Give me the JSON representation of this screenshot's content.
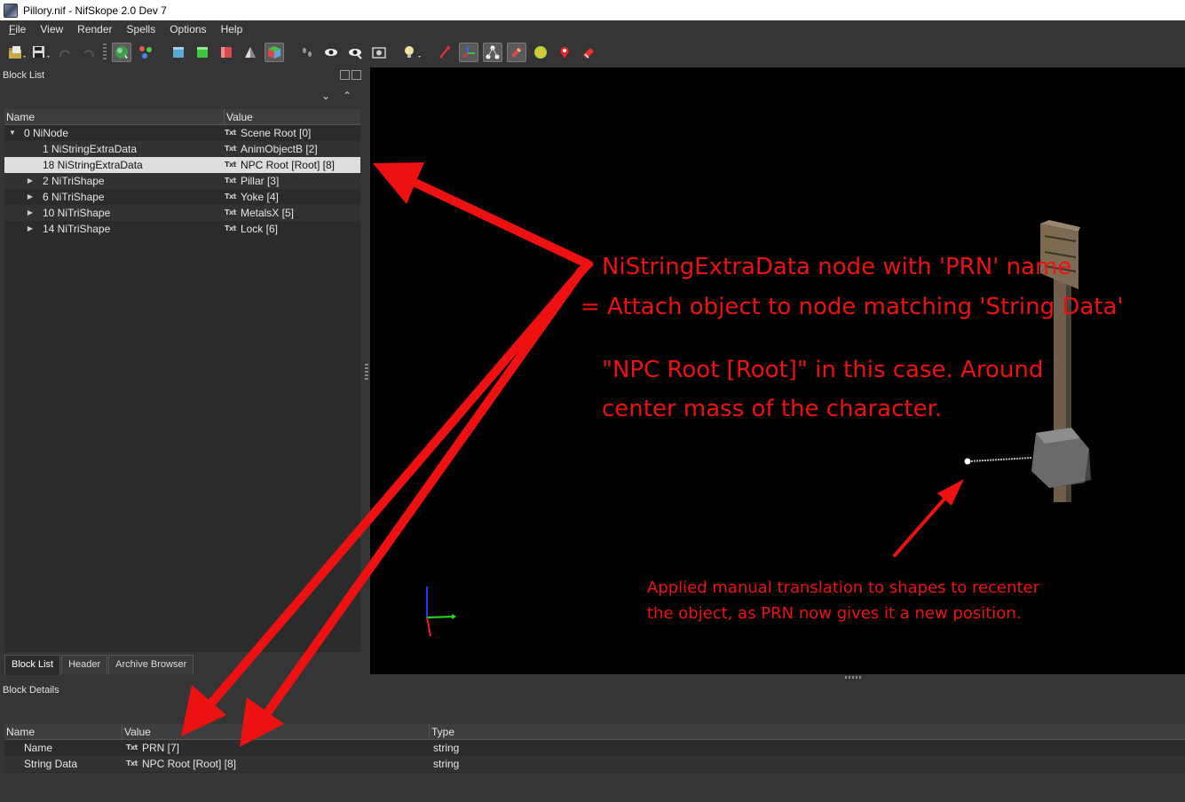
{
  "window": {
    "title": "Pillory.nif - NifSkope 2.0 Dev 7"
  },
  "menu": [
    {
      "label": "File",
      "ul": "F",
      "rest": "ile"
    },
    {
      "label": "View",
      "ul": "",
      "rest": "View"
    },
    {
      "label": "Render",
      "ul": "",
      "rest": "Render"
    },
    {
      "label": "Spells",
      "ul": "",
      "rest": "Spells"
    },
    {
      "label": "Options",
      "ul": "",
      "rest": "Options"
    },
    {
      "label": "Help",
      "ul": "",
      "rest": "Help"
    }
  ],
  "toolbar_icons": [
    "open-icon",
    "save-icon",
    "undo-icon",
    "redo-icon",
    "select-mode-icon",
    "lod-icon",
    "view-top-icon",
    "view-front-icon",
    "view-side-icon",
    "view-flip-icon",
    "perspective-icon",
    "walk-icon",
    "eye-icon",
    "eye-visible-icon",
    "screenshot-icon",
    "light-icon",
    "marker-icon",
    "axes-icon",
    "nodes-icon",
    "constraints-icon",
    "furniture-icon",
    "markers-pin-icon",
    "havok-icon"
  ],
  "block_list": {
    "title": "Block List",
    "columns": {
      "name": "Name",
      "value": "Value"
    },
    "rows": [
      {
        "name": "0 NiNode",
        "value": "Scene Root [0]"
      },
      {
        "name": "1 NiStringExtraData",
        "value": "AnimObjectB [2]"
      },
      {
        "name": "18 NiStringExtraData",
        "value": "NPC Root [Root] [8]"
      },
      {
        "name": "2 NiTriShape",
        "value": "Pillar [3]"
      },
      {
        "name": "6 NiTriShape",
        "value": "Yoke [4]"
      },
      {
        "name": "10 NiTriShape",
        "value": "MetalsX [5]"
      },
      {
        "name": "14 NiTriShape",
        "value": "Lock [6]"
      }
    ],
    "txt_tag": "Txt"
  },
  "tabs": [
    "Block List",
    "Header",
    "Archive Browser"
  ],
  "block_details": {
    "title": "Block Details",
    "columns": {
      "name": "Name",
      "value": "Value",
      "type": "Type"
    },
    "rows": [
      {
        "name": "Name",
        "value": "PRN [7]",
        "type": "string"
      },
      {
        "name": "String Data",
        "value": "NPC Root [Root] [8]",
        "type": "string"
      }
    ]
  },
  "annotations": {
    "line1": "NiStringExtraData node with 'PRN' name",
    "line2": "= Attach object to node matching 'String Data'",
    "line3": "\"NPC Root [Root]\" in this case. Around",
    "line4": "center mass of the character.",
    "note1": "Applied manual translation to shapes to recenter",
    "note2": "the object, as PRN now gives it a new position.",
    "color": "#ee1111"
  }
}
